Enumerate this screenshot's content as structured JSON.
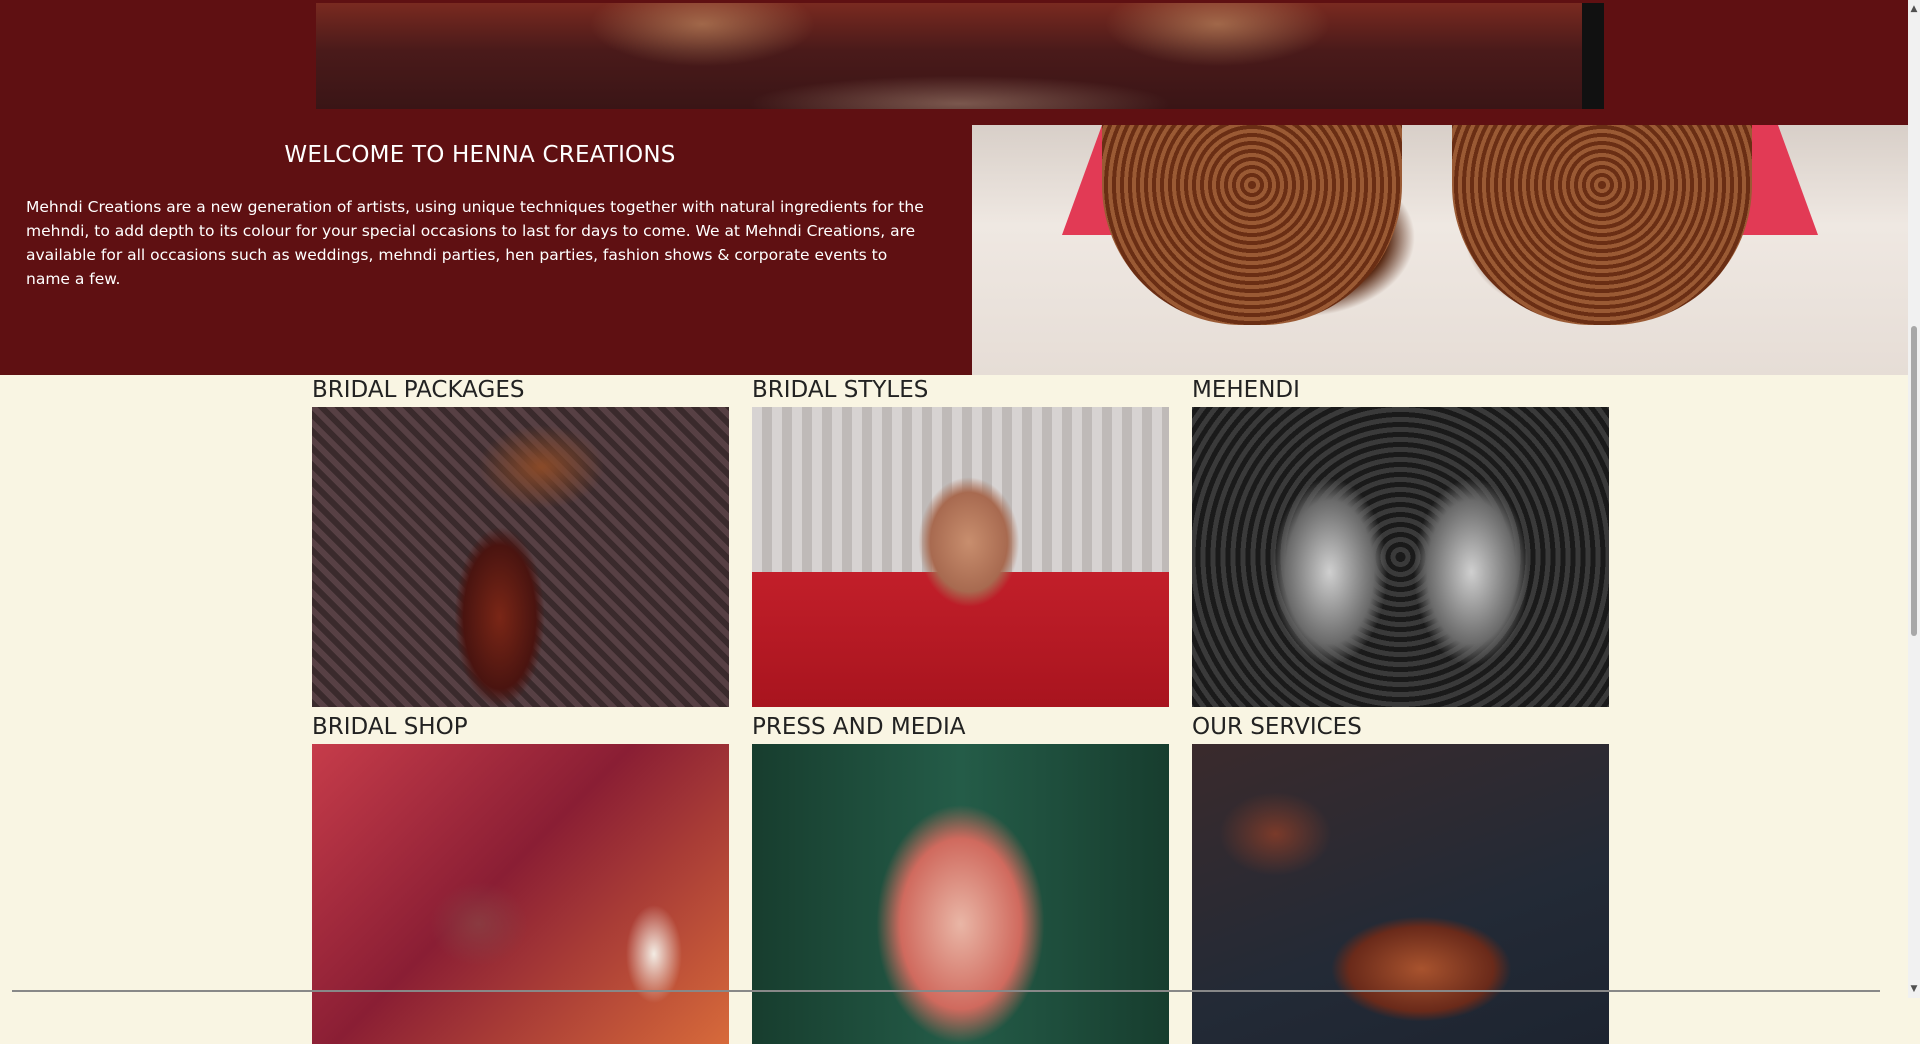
{
  "welcome": {
    "title": "WELCOME TO HENNA CREATIONS",
    "text": "Mehndi Creations are a new generation of artists, using unique techniques together with natural ingredients for the mehndi, to add depth to its colour for your special occasions to last for days to come. We at Mehndi Creations, are available for all occasions such as weddings, mehndi parties, hen parties, fashion shows & corporate events to name a few."
  },
  "gallery": [
    {
      "label": "BRIDAL PACKAGES"
    },
    {
      "label": "BRIDAL STYLES"
    },
    {
      "label": "MEHENDI"
    },
    {
      "label": "BRIDAL SHOP"
    },
    {
      "label": "PRESS AND MEDIA"
    },
    {
      "label": "OUR SERVICES"
    }
  ],
  "colors": {
    "maroon": "#5f1012",
    "cream": "#f9f5e3"
  },
  "icons": {
    "scroll_up": "scroll-up-icon",
    "scroll_down": "scroll-down-icon"
  }
}
